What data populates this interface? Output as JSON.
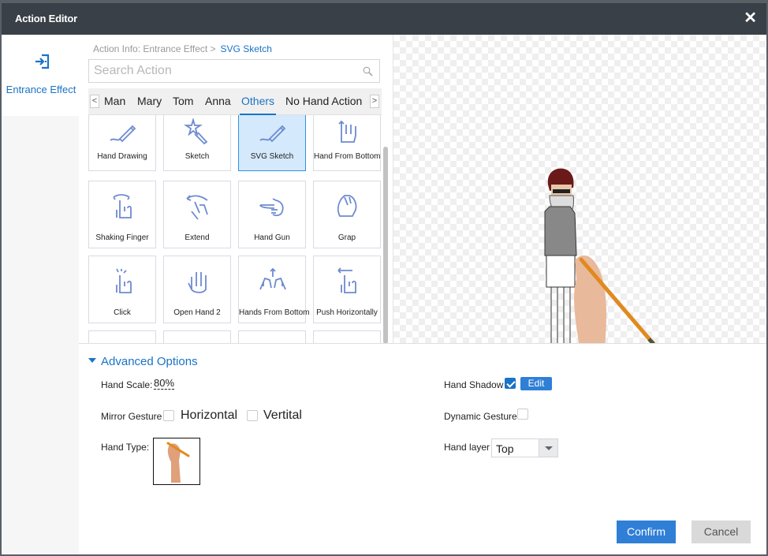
{
  "window": {
    "title": "Action Editor",
    "close_icon": "close-icon"
  },
  "sidebar": {
    "items": [
      {
        "label": "Entrance Effect",
        "icon": "enter-icon",
        "active": true
      }
    ]
  },
  "breadcrumb": {
    "prefix": "Action Info: Entrance Effect >",
    "current": "SVG Sketch"
  },
  "search": {
    "placeholder": "Search Action",
    "value": "",
    "icon": "search-icon"
  },
  "tabs": {
    "items": [
      "Man",
      "Mary",
      "Tom",
      "Anna",
      "Others",
      "No Hand Action"
    ],
    "active": "Others",
    "prev_icon": "chevron-left-icon",
    "next_icon": "chevron-right-icon"
  },
  "actions": [
    {
      "label": "Hand Drawing",
      "icon": "pencil-draw-icon"
    },
    {
      "label": "Sketch",
      "icon": "star-pencil-icon"
    },
    {
      "label": "SVG Sketch",
      "icon": "pencil-draw-icon",
      "selected": true
    },
    {
      "label": "Hand From Bottom",
      "icon": "hand-up-icon"
    },
    {
      "label": "Shaking Finger",
      "icon": "shaking-finger-icon"
    },
    {
      "label": "Extend",
      "icon": "extend-hand-icon"
    },
    {
      "label": "Hand Gun",
      "icon": "hand-gun-icon"
    },
    {
      "label": "Grap",
      "icon": "grab-hand-icon"
    },
    {
      "label": "Click",
      "icon": "click-finger-icon"
    },
    {
      "label": "Open Hand 2",
      "icon": "open-hand-icon"
    },
    {
      "label": "Hands From Bottom",
      "icon": "two-hands-icon"
    },
    {
      "label": "Push Horizontally",
      "icon": "push-finger-icon"
    }
  ],
  "advanced": {
    "title": "Advanced Options",
    "hand_scale_label": "Hand Scale:",
    "hand_scale_value": "80%",
    "mirror_label": "Mirror Gesture",
    "mirror_horizontal_label": "Horizontal",
    "mirror_horizontal_checked": false,
    "mirror_vertical_label": "Vertital",
    "mirror_vertical_checked": false,
    "hand_type_label": "Hand Type:",
    "hand_shadow_label": "Hand Shadow",
    "hand_shadow_checked": true,
    "edit_label": "Edit",
    "dynamic_gesture_label": "Dynamic Gesture",
    "dynamic_gesture_checked": false,
    "hand_layer_label": "Hand layer",
    "hand_layer_value": "Top"
  },
  "footer": {
    "confirm_label": "Confirm",
    "cancel_label": "Cancel"
  },
  "colors": {
    "accent": "#1a73c6",
    "titlebar": "#394047",
    "button": "#2f7fd6",
    "selected_card": "#d4e9fb"
  }
}
